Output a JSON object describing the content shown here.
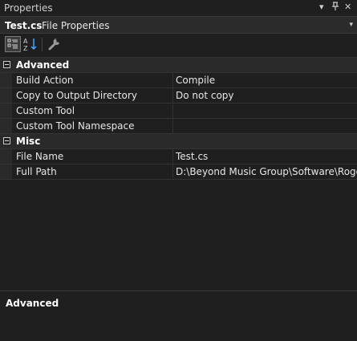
{
  "window": {
    "title": "Properties",
    "controls": {
      "dropdown": "▾",
      "pin": "⊥",
      "close": "✕"
    }
  },
  "object_selector": {
    "name": "Test.cs",
    "type": "File Properties",
    "dropdown_glyph": "▾"
  },
  "toolbar": {
    "buttons": [
      {
        "name": "categorized-view",
        "active": true
      },
      {
        "name": "alphabetical-sort",
        "active": false
      },
      {
        "name": "property-pages",
        "active": false
      }
    ]
  },
  "grid": {
    "categories": [
      {
        "label": "Advanced",
        "rows": [
          {
            "name": "Build Action",
            "value": "Compile"
          },
          {
            "name": "Copy to Output Directory",
            "value": "Do not copy"
          },
          {
            "name": "Custom Tool",
            "value": ""
          },
          {
            "name": "Custom Tool Namespace",
            "value": ""
          }
        ]
      },
      {
        "label": "Misc",
        "rows": [
          {
            "name": "File Name",
            "value": "Test.cs"
          },
          {
            "name": "Full Path",
            "value": "D:\\Beyond Music Group\\Software\\Rogord\\"
          }
        ]
      }
    ]
  },
  "description": {
    "title": "Advanced"
  },
  "colors": {
    "background": "#1f1f1f",
    "category": "#2a2a2a",
    "grid_line": "#333333",
    "text": "#e6e6e6"
  }
}
